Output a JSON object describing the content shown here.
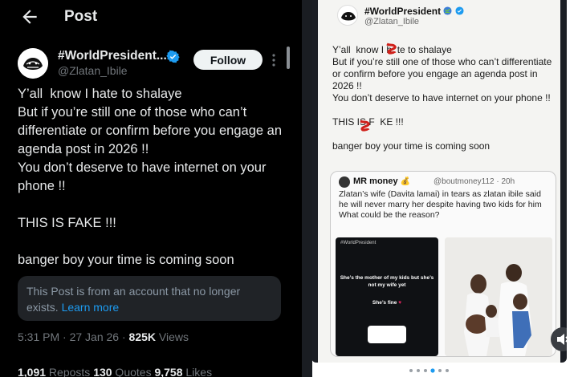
{
  "header": {
    "title": "Post",
    "back_icon": "arrow-left-icon"
  },
  "author": {
    "name": "#WorldPresident...",
    "handle": "@Zlatan_Ibile",
    "follow_label": "Follow",
    "verified_icon": "verified-badge-icon",
    "more_icon": "more-vertical-icon",
    "verified_color": "#1d9bf0"
  },
  "tweet": {
    "lines": [
      "Y’all  know I hate to shalaye",
      "But if you’re still one of those who can’t differentiate or confirm before you engage an agenda post in 2026 !!",
      "You don’t deserve to have internet on your phone !!",
      "",
      "THIS IS FAKE !!!",
      "",
      "banger boy your time is coming soon"
    ]
  },
  "notice": {
    "text": "This Post is from an account that no longer exists.",
    "link": "Learn more",
    "link_color": "#1d9bf0"
  },
  "meta": {
    "time": "5:31 PM · 27 Jan 26 · ",
    "views_count": "825K",
    "views_label": " Views"
  },
  "stats": {
    "reposts_count": "1,091",
    "reposts_label": " Reposts  ",
    "quotes_count": "130",
    "quotes_label": " Quotes  ",
    "likes_count": "9,758",
    "likes_label": " Likes"
  },
  "screenshot": {
    "name": "#WorldPresident",
    "handle": "@Zlatan_Ibile",
    "lines": [
      "Y’all  know I h  te to shalaye",
      "But if you’re still one of those who can’t differentiate or confirm before you engage an agenda post in 2026 !!",
      "You don’t deserve to have internet on your phone !!",
      "",
      "THIS IS F  KE !!!",
      "",
      "banger boy your time is coming soon"
    ],
    "quote": {
      "name": "MR money",
      "rest": "@boutmoney112 · 20h",
      "text": "Zlatan’s wife (Davita lamai) in tears as zlatan ibile said he will never marry her despite having two kids for him\nWhat could be the reason?",
      "image1": {
        "top": "#WorldPresident",
        "msg": "She’s the mother of my kids but she’s not my wife yet",
        "fine": "She’s fine"
      }
    },
    "mute_icon": "speaker-muted-icon",
    "red_mark_color": "#d0201a"
  }
}
